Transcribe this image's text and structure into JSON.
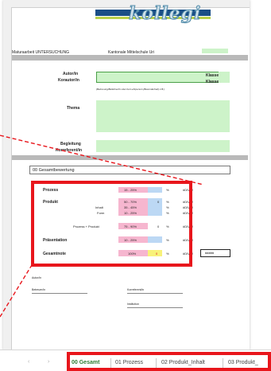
{
  "header": {
    "logo_text": "kollegi",
    "left_title": "Maturaarbeit UNTERSUCHUNG",
    "center_title": "Kantonale Mittelschule Uri"
  },
  "fields": {
    "autor_label": "Autor/in",
    "korautor_label": "Korautor/in",
    "klasse1_label": "Klasse",
    "klasse2_label": "Klasse",
    "hint_text": "(Betreuung/Beilehrer/in oder bei Lehrperson (Besonderheit) z.B.)",
    "thema_label": "Thema",
    "begleitung_label": "Begleitung",
    "korreferent_label": "Korreferent/in"
  },
  "section": {
    "title": "00  Gesamtbewertung"
  },
  "grading": {
    "rows": [
      {
        "name": "Prozess",
        "range": "15 - 25%",
        "unit": "%",
        "result": "#DIV/0!"
      },
      {
        "name": "Produkt",
        "range": "50 - 70%",
        "pct": "0",
        "unit": "%",
        "result": "#DIV/0!"
      },
      {
        "name": "Inhalt",
        "range": "35 - 45%",
        "unit": "%",
        "result": "#DIV/0!"
      },
      {
        "name": "Form",
        "range": "10 - 25%",
        "unit": "%",
        "result": "#DIV/0!"
      },
      {
        "name": "Prozess + Produkt",
        "range": "75 - 90%",
        "pct": "0",
        "unit": "%",
        "result": "#DIV/0!"
      },
      {
        "name": "Präsentation",
        "range": "10 - 25%",
        "unit": "%",
        "result": "#DIV/0!"
      },
      {
        "name": "Gesamtnote",
        "range": "100%",
        "pct": "0",
        "unit": "%",
        "result": "#DIV/0!",
        "final": "#####"
      }
    ]
  },
  "signatures": {
    "s1": "Autor/in",
    "s2": "Betreuer/in",
    "s3": "Korreferent/in",
    "s4": "Institution"
  },
  "tabs": [
    {
      "label": "00 Gesamt",
      "active": true
    },
    {
      "label": "01 Prozess",
      "active": false
    },
    {
      "label": "02 Produkt_Inhalt",
      "active": false
    },
    {
      "label": "03 Produkt_",
      "active": false
    }
  ],
  "colors": {
    "highlight": "#e8161c",
    "active_tab": "#2e7d32"
  }
}
